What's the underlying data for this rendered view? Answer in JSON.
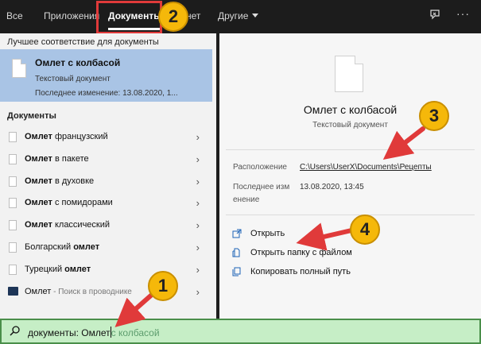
{
  "top_tabs": [
    {
      "label": "Все"
    },
    {
      "label": "Приложения"
    },
    {
      "label": "Документы",
      "active": true
    },
    {
      "label": "Интернет",
      "partial": "нет"
    },
    {
      "label": "Другие"
    }
  ],
  "left": {
    "best_match_header": "Лучшее соответствие для документы",
    "best": {
      "title": "Омлет с колбасой",
      "type": "Текстовый документ",
      "modified": "Последнее изменение: 13.08.2020, 1..."
    },
    "docs_header": "Документы",
    "items": [
      {
        "bold": "Омлет",
        "rest": " французский"
      },
      {
        "bold": "Омлет",
        "rest": " в пакете"
      },
      {
        "bold": "Омлет",
        "rest": " в духовке"
      },
      {
        "bold": "Омлет",
        "rest": " с помидорами"
      },
      {
        "bold": "Омлет",
        "rest": " классический"
      },
      {
        "pre": "Болгарский ",
        "bold": "омлет"
      },
      {
        "pre": "Турецкий ",
        "bold": "омлет"
      }
    ],
    "explorer_item": {
      "label": "Омлет",
      "hint": " - Поиск в проводнике"
    }
  },
  "right": {
    "title": "Омлет с колбасой",
    "subtitle": "Текстовый документ",
    "location_key": "Расположение",
    "location_val": "C:\\Users\\UserX\\Documents\\Рецепты",
    "modified_key_1": "Последнее изм",
    "modified_key_2": "енение",
    "modified_val": "13.08.2020, 13:45",
    "actions": [
      {
        "label": "Открыть"
      },
      {
        "label": "Открыть папку с файлом"
      },
      {
        "label": "Копировать полный путь"
      }
    ]
  },
  "search": {
    "typed": "документы: Омлет",
    "suggestion": "с колбасой"
  },
  "annotations": [
    "1",
    "2",
    "3",
    "4"
  ],
  "colors": {
    "highlight": "#a9c4e5",
    "badge": "#f5b80a",
    "arrow": "#e03a3a",
    "search_bg": "#c6eec6"
  }
}
